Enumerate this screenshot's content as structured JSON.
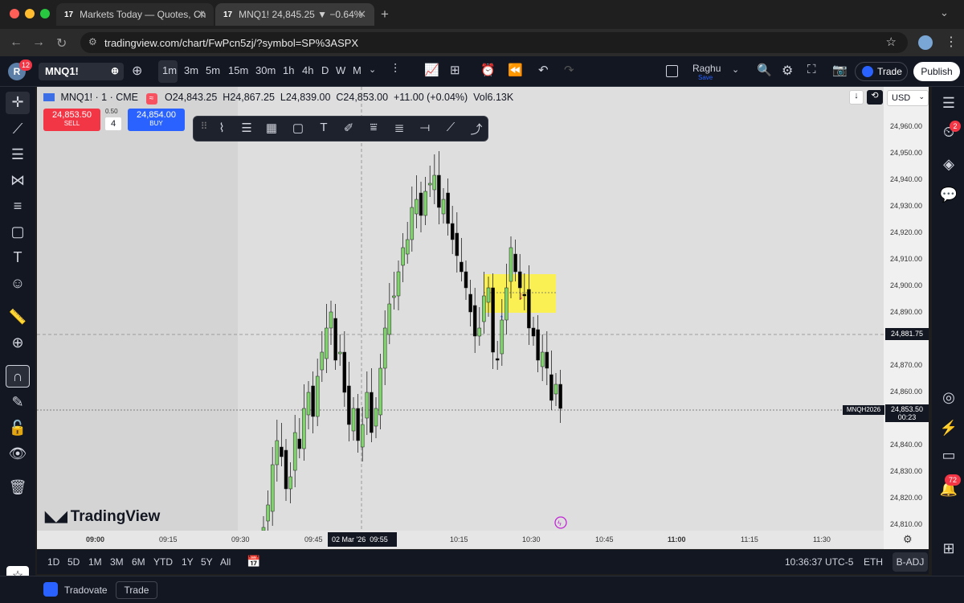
{
  "browser": {
    "tabs": [
      {
        "title": "Markets Today — Quotes, Ch",
        "active": false
      },
      {
        "title": "MNQ1! 24,845.25 ▼ −0.64%",
        "active": true
      }
    ],
    "url": "tradingview.com/chart/FwPcn5zj/?symbol=SP%3ASPX"
  },
  "toolbar": {
    "avatar_letter": "R",
    "notif_count": "12",
    "symbol": "MNQ1!",
    "intervals": [
      "1m",
      "3m",
      "5m",
      "15m",
      "30m",
      "1h",
      "4h",
      "D",
      "W",
      "M"
    ],
    "active_interval": "1m",
    "layout_name": "Raghu",
    "layout_status": "Save",
    "trade_label": "Trade",
    "publish_label": "Publish"
  },
  "legend": {
    "symbol": "MNQ1! · 1 · CME",
    "open": "O24,843.25",
    "high": "H24,867.25",
    "low": "L24,839.00",
    "close": "C24,853.00",
    "change": "+11.00 (+0.04%)",
    "volume": "Vol6.13K"
  },
  "order": {
    "sell_price": "24,853.50",
    "sell_label": "SELL",
    "spread": "0.50",
    "qty": "4",
    "buy_price": "24,854.00",
    "buy_label": "BUY"
  },
  "chart": {
    "currency": "USD",
    "price_ticks": [
      "24,960.00",
      "24,950.00",
      "24,940.00",
      "24,930.00",
      "24,920.00",
      "24,910.00",
      "24,900.00",
      "24,890.00",
      "24,870.00",
      "24,860.00",
      "24,840.00",
      "24,830.00",
      "24,820.00",
      "24,810.00"
    ],
    "crosshair_price": "24,881.75",
    "last_price": "24,853.50",
    "countdown": "00:23",
    "contract": "MNQH2026",
    "time_ticks": [
      "09:00",
      "09:15",
      "09:30",
      "09:45",
      "09:55",
      "10:15",
      "10:30",
      "10:45",
      "11:00",
      "11:15",
      "11:30"
    ],
    "crosshair_time": "02 Mar '26",
    "watermark": "TradingView",
    "colors": {
      "up": "#7ed36b",
      "down": "#000000",
      "zone": "#fff23b"
    }
  },
  "bottom": {
    "ranges": [
      "1D",
      "5D",
      "1M",
      "3M",
      "6M",
      "YTD",
      "1Y",
      "5Y",
      "All"
    ],
    "clock": "10:36:37 UTC-5",
    "session": "ETH",
    "adj": "B-ADJ"
  },
  "status": {
    "broker": "Tradovate",
    "trade_button": "Trade"
  },
  "right": {
    "alerts_badge": "2",
    "notif_badge": "72"
  }
}
